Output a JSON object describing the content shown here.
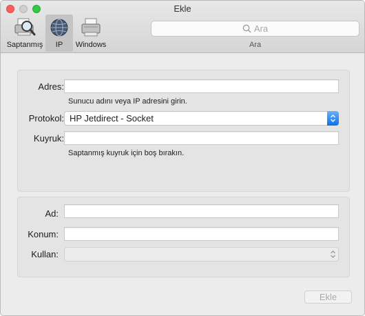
{
  "window": {
    "title": "Ekle"
  },
  "toolbar": {
    "items": [
      {
        "label": "Saptanmış",
        "icon": "default-printer-icon",
        "selected": false
      },
      {
        "label": "IP",
        "icon": "ip-globe-icon",
        "selected": true
      },
      {
        "label": "Windows",
        "icon": "windows-printer-icon",
        "selected": false
      }
    ],
    "search": {
      "placeholder": "Ara",
      "caption": "Ara"
    }
  },
  "form": {
    "address_label": "Adres:",
    "address_value": "",
    "address_hint": "Sunucu adını veya IP adresini girin.",
    "protocol_label": "Protokol:",
    "protocol_value": "HP Jetdirect - Socket",
    "queue_label": "Kuyruk:",
    "queue_value": "",
    "queue_hint": "Saptanmış kuyruk için boş bırakın.",
    "name_label": "Ad:",
    "name_value": "",
    "location_label": "Konum:",
    "location_value": "",
    "use_label": "Kullan:",
    "use_value": ""
  },
  "buttons": {
    "add": "Ekle"
  },
  "colors": {
    "accent": "#1a7cf0",
    "close": "#fc605c",
    "zoom": "#34c84a"
  }
}
